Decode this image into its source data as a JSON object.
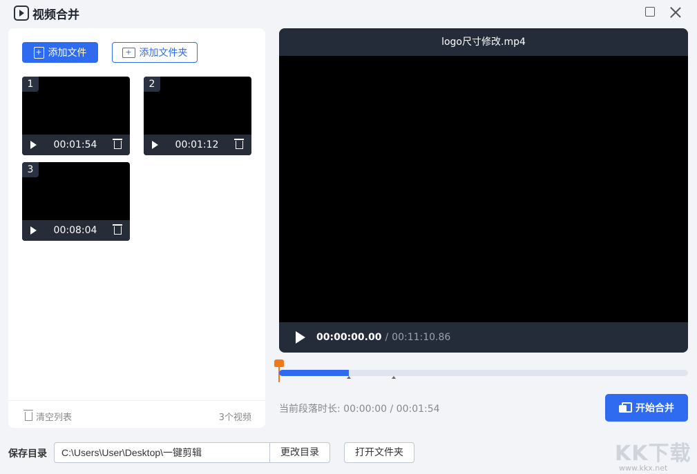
{
  "app": {
    "title": "视频合并"
  },
  "left": {
    "add_file_label": "添加文件",
    "add_folder_label": "添加文件夹",
    "videos": [
      {
        "index": "1",
        "duration": "00:01:54"
      },
      {
        "index": "2",
        "duration": "00:01:12"
      },
      {
        "index": "3",
        "duration": "00:08:04"
      }
    ],
    "clear_list_label": "清空列表",
    "video_count": "3个视频"
  },
  "player": {
    "filename": "logo尺寸修改.mp4",
    "current_time": "00:00:00.00",
    "separator": "/",
    "total_time": "00:11:10.86"
  },
  "timeline": {
    "progress_fraction": 0.17,
    "segment_bounds_fraction": [
      0.17,
      0.28
    ]
  },
  "segment": {
    "info": "当前段落时长: 00:00:00 / 00:01:54"
  },
  "merge_button_label": "开始合并",
  "save": {
    "label": "保存目录",
    "path": "C:\\Users\\User\\Desktop\\一键剪辑",
    "change_dir_label": "更改目录",
    "open_folder_label": "打开文件夹"
  },
  "watermark": {
    "text": "KK下载",
    "url": "www.kkx.net"
  },
  "colors": {
    "accent": "#2f6bf0",
    "playhead": "#f07a18",
    "player_bg": "#242b39"
  }
}
